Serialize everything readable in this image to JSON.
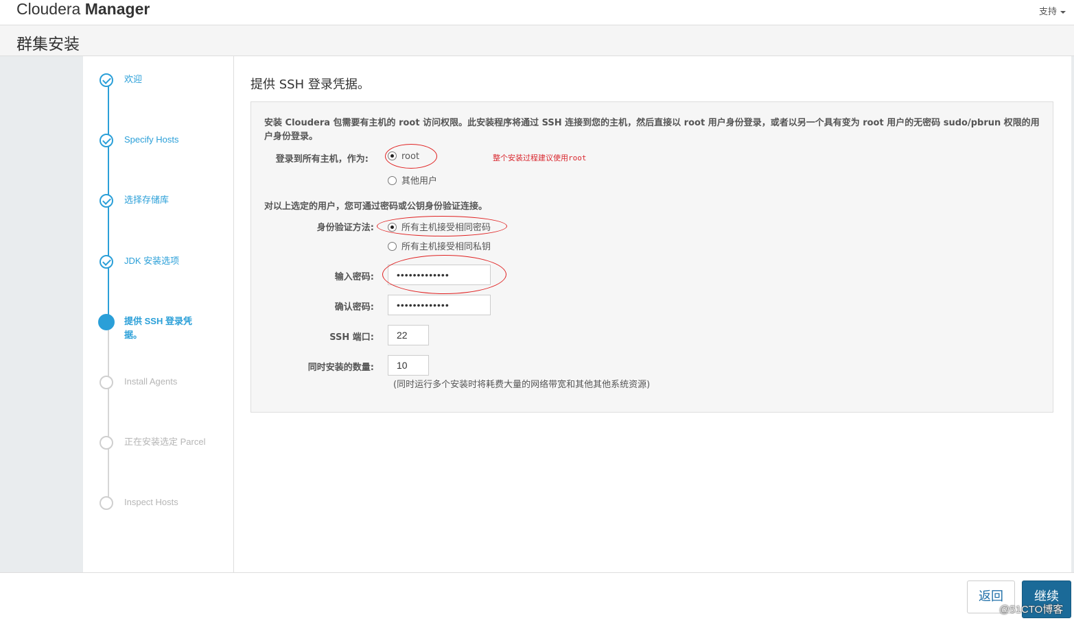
{
  "header": {
    "brand_light": "Cloudera",
    "brand_bold": "Manager",
    "support": "支持"
  },
  "page_title": "群集安装",
  "steps": [
    {
      "label": "欢迎",
      "state": "done"
    },
    {
      "label": "Specify Hosts",
      "state": "done"
    },
    {
      "label": "选择存储库",
      "state": "done"
    },
    {
      "label": "JDK 安装选项",
      "state": "done"
    },
    {
      "label": "提供 SSH 登录凭据。",
      "state": "current"
    },
    {
      "label": "Install Agents",
      "state": "todo"
    },
    {
      "label": "正在安装选定 Parcel",
      "state": "todo"
    },
    {
      "label": "Inspect Hosts",
      "state": "todo"
    }
  ],
  "main": {
    "title": "提供 SSH 登录凭据。",
    "description": "安装 Cloudera 包需要有主机的 root 访问权限。此安装程序将通过 SSH 连接到您的主机，然后直接以 root 用户身份登录，或者以另一个具有变为 root 用户的无密码 sudo/pbrun 权限的用户身份登录。",
    "login_label": "登录到所有主机，作为:",
    "login_options": [
      "root",
      "其他用户"
    ],
    "annotation": "整个安装过程建议使用root",
    "auth_description": "对以上选定的用户，您可通过密码或公钥身份验证连接。",
    "auth_label": "身份验证方法:",
    "auth_options": [
      "所有主机接受相同密码",
      "所有主机接受相同私钥"
    ],
    "password_label": "输入密码:",
    "password_value": "•••••••••••••",
    "confirm_label": "确认密码:",
    "confirm_value": "•••••••••••••",
    "ssh_port_label": "SSH 端口:",
    "ssh_port_value": "22",
    "concurrent_label": "同时安装的数量:",
    "concurrent_value": "10",
    "concurrent_hint": "(同时运行多个安装时将耗费大量的网络带宽和其他其他系统资源)"
  },
  "footer": {
    "back": "返回",
    "next": "继续"
  },
  "watermark": "@51CTO博客",
  "colors": {
    "accent": "#2a9fd8",
    "primary_button": "#1b6a98",
    "annotation_red": "#e02020"
  }
}
